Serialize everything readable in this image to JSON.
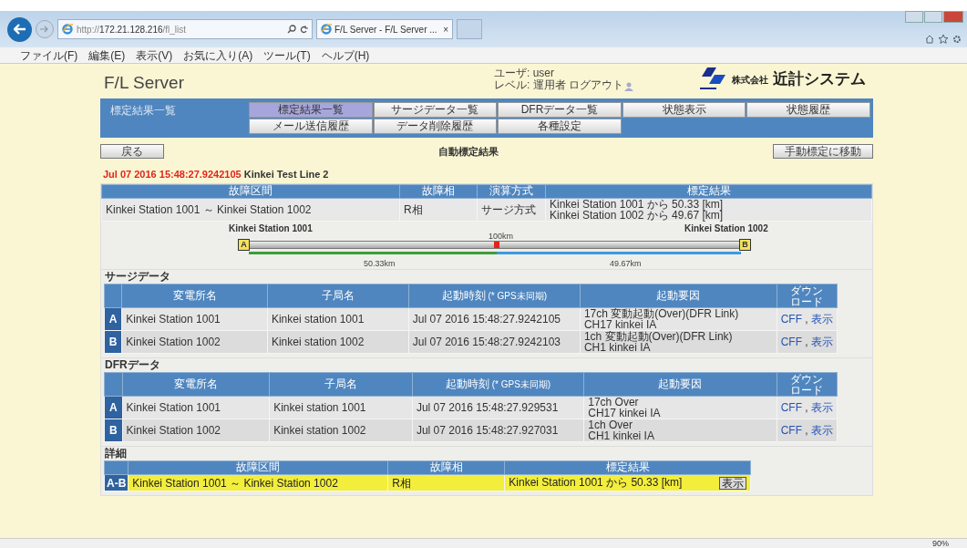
{
  "browser": {
    "address": "http://**172.21.128.216**/fl_list",
    "tab_title": "F/L Server - F/L Server ...",
    "tab_close": "×",
    "menu": [
      "ファイル(F)",
      "編集(E)",
      "表示(V)",
      "お気に入り(A)",
      "ツール(T)",
      "ヘルプ(H)"
    ],
    "zoom": "90%"
  },
  "header": {
    "app_title": "F/L Server",
    "user_label": "ユーザ: user",
    "level_label": "レベル: 運用者",
    "logout": "ログアウト",
    "company": "株式会社",
    "company_name": "近計システム"
  },
  "nav": {
    "title": "標定結果一覧",
    "items": [
      {
        "label": "標定結果一覧",
        "selected": true
      },
      {
        "label": "サージデータ一覧",
        "selected": false
      },
      {
        "label": "DFRデータ一覧",
        "selected": false
      },
      {
        "label": "状態表示",
        "selected": false
      },
      {
        "label": "状態履歴",
        "selected": false
      },
      {
        "label": "メール送信履歴",
        "selected": false
      },
      {
        "label": "データ削除履歴",
        "selected": false
      },
      {
        "label": "各種設定",
        "selected": false
      }
    ]
  },
  "toolbar": {
    "back_button": "戻る",
    "heading": "自動標定結果",
    "manual_button": "手動標定に移動"
  },
  "event": {
    "timestamp": "Jul 07 2016 15:48:27.9242105",
    "line": "Kinkei Test Line 2"
  },
  "summary": {
    "columns": [
      "故障区間",
      "故障相",
      "演算方式",
      "標定結果"
    ],
    "row": {
      "section": "Kinkei Station 1001 ～ Kinkei Station 1002",
      "phase": "R相",
      "method": "サージ方式",
      "result": [
        "Kinkei Station 1001 から 50.33 [km]",
        "Kinkei Station 1002 から 49.67 [km]"
      ]
    }
  },
  "line_diagram": {
    "station_a": "Kinkei Station 1001",
    "station_b": "Kinkei Station 1002",
    "end_a": "A",
    "end_b": "B",
    "total": "100km",
    "level": 0.5033,
    "distance_a": "50.33km",
    "distance_b": "49.67km"
  },
  "surge": {
    "title": "サージデータ",
    "columns": [
      "変電所名",
      "子局名",
      "起動時刻",
      "起動要因",
      "ダウンロード"
    ],
    "time_note": "(* GPS未同期)",
    "rows": [
      {
        "end": "A",
        "station": "Kinkei Station 1001",
        "unit": "Kinkei station 1001",
        "time": "Jul 07 2016 15:48:27.9242105",
        "cause": [
          "17ch 変動起動(Over)(DFR Link)",
          "CH17 kinkei IA"
        ],
        "links": [
          "CFF",
          "表示"
        ],
        "separator": ","
      },
      {
        "end": "B",
        "station": "Kinkei Station 1002",
        "unit": "Kinkei station 1002",
        "time": "Jul 07 2016 15:48:27.9242103",
        "cause": [
          "1ch 変動起動(Over)(DFR Link)",
          "CH1 kinkei IA"
        ],
        "links": [
          "CFF",
          "表示"
        ],
        "separator": ","
      }
    ]
  },
  "dfr": {
    "title": "DFRデータ",
    "columns": [
      "変電所名",
      "子局名",
      "起動時刻",
      "起動要因",
      "ダウンロード"
    ],
    "time_note": "(* GPS未同期)",
    "rows": [
      {
        "end": "A",
        "station": "Kinkei Station 1001",
        "unit": "Kinkei station 1001",
        "time": "Jul 07 2016 15:48:27.929531",
        "cause": [
          "17ch Over",
          "CH17 kinkei IA"
        ],
        "links": [
          "CFF",
          "表示"
        ],
        "separator": ","
      },
      {
        "end": "B",
        "station": "Kinkei Station 1002",
        "unit": "Kinkei station 1002",
        "time": "Jul 07 2016 15:48:27.927031",
        "cause": [
          "1ch Over",
          "CH1 kinkei IA"
        ],
        "links": [
          "CFF",
          "表示"
        ],
        "separator": ","
      }
    ]
  },
  "detail": {
    "title": "詳細",
    "columns": [
      "故障区間",
      "故障相",
      "標定結果"
    ],
    "rows": [
      {
        "end": "A-B",
        "section": "Kinkei Station 1001 ～ Kinkei Station 1002",
        "phase": "R相",
        "result": "Kinkei Station 1001 から 50.33 [km]",
        "button": "表示",
        "selected": true
      }
    ]
  }
}
